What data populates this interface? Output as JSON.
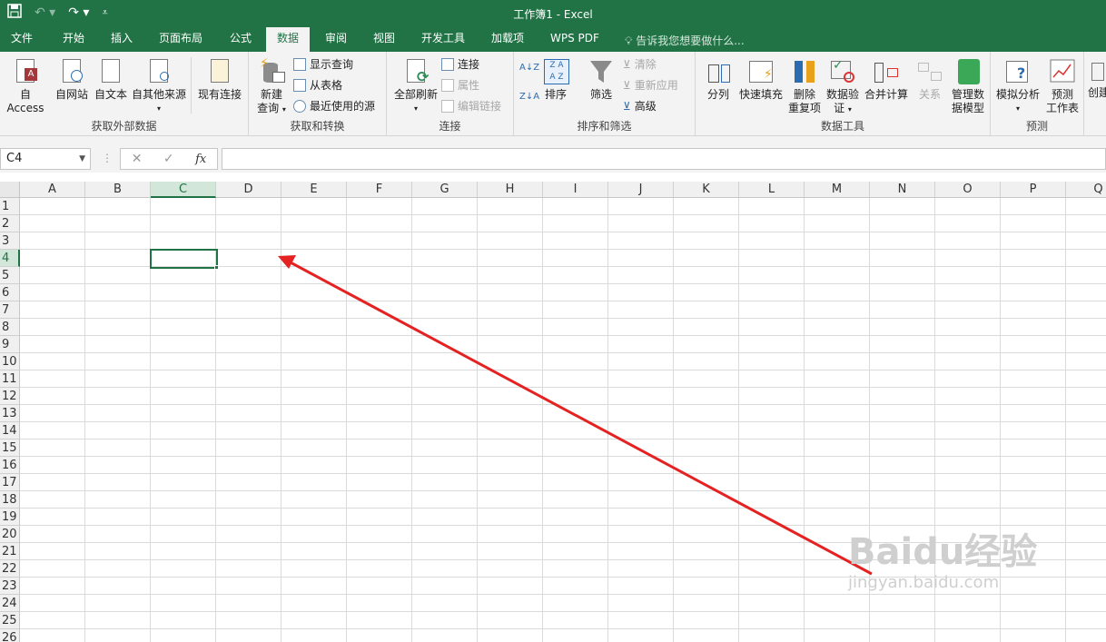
{
  "window": {
    "title": "工作簿1 - Excel"
  },
  "quick_access": {
    "save_icon": "save-icon",
    "undo_icon": "undo-icon",
    "redo_icon": "redo-icon",
    "customize_icon": "customize-icon"
  },
  "tabs": [
    "文件",
    "开始",
    "插入",
    "页面布局",
    "公式",
    "数据",
    "审阅",
    "视图",
    "开发工具",
    "加载项",
    "WPS PDF"
  ],
  "active_tab": "数据",
  "tell_me": "告诉我您想要做什么...",
  "ribbon": {
    "groups": [
      {
        "label": "获取外部数据",
        "buttons": [
          "自 Access",
          "自网站",
          "自文本",
          "自其他来源",
          "现有连接"
        ]
      },
      {
        "label": "获取和转换",
        "big": [
          "新建",
          "查询"
        ],
        "small": [
          "显示查询",
          "从表格",
          "最近使用的源"
        ]
      },
      {
        "label": "连接",
        "big": "全部刷新",
        "small": [
          "连接",
          "属性",
          "编辑链接"
        ]
      },
      {
        "label": "排序和筛选",
        "big": [
          "排序",
          "筛选"
        ],
        "small": [
          "清除",
          "重新应用",
          "高级"
        ]
      },
      {
        "label": "数据工具",
        "buttons": [
          "分列",
          "快速填充",
          "删除",
          "重复项",
          "数据验",
          "证",
          "合并计算",
          "关系",
          "管理数",
          "据模型"
        ]
      },
      {
        "label": "预测",
        "buttons": [
          "模拟分析",
          "预测",
          "工作表"
        ]
      },
      {
        "label": "",
        "buttons": [
          "创建"
        ]
      }
    ]
  },
  "formula_bar": {
    "name_box": "C4",
    "cancel": "✕",
    "enter": "✓",
    "fx": "fx",
    "value": ""
  },
  "sheet": {
    "columns": [
      "A",
      "B",
      "C",
      "D",
      "E",
      "F",
      "G",
      "H",
      "I",
      "J",
      "K",
      "L",
      "M",
      "N",
      "O",
      "P",
      "Q"
    ],
    "rows": [
      "1",
      "2",
      "3",
      "4",
      "5",
      "6",
      "7",
      "8",
      "9",
      "10",
      "11",
      "12",
      "13",
      "14",
      "15",
      "16",
      "17",
      "18",
      "19",
      "20",
      "21",
      "22",
      "23",
      "24",
      "25",
      "26"
    ],
    "selected_column": "C",
    "selected_row": "4",
    "annotation_color": "#e52222"
  },
  "watermark": {
    "line1": "Baidu经验",
    "line2": "jingyan.baidu.com"
  }
}
